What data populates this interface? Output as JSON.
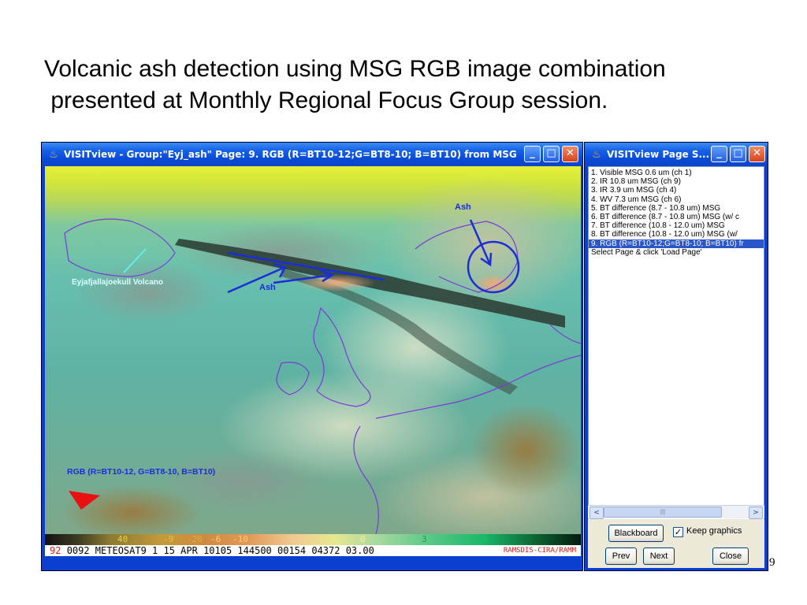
{
  "slide": {
    "title_line1": "Volcanic ash detection using MSG RGB image combination",
    "title_line2": " presented at Monthly Regional Focus Group session.",
    "page_number": "9"
  },
  "main_window": {
    "title": "VISITview - Group:\"Eyj_ash\" Page: 9. RGB (R=BT10-12;G=BT8-10; B=BT10) from MSG",
    "minimize": "_",
    "maximize": "□",
    "close": "✕",
    "annotations": {
      "ash_label_right": "Ash",
      "ash_label_left": "Ash",
      "volcano_label": "Eyjafjallajoekull Volcano",
      "rgb_label": "RGB (R=BT10-12, G=BT8-10, B=BT10)"
    },
    "colorbar_ticks": [
      "40",
      "-9",
      "-20",
      "-6",
      "-10",
      "0",
      "3",
      "6"
    ],
    "status": {
      "code": "92",
      "text": "0092 METEOSAT9   1 15 APR 10105 144500 00154 04372 03.00",
      "source": "RAMSDIS-CIRA/RAMM"
    }
  },
  "page_window": {
    "title": "VISITview Page S...",
    "minimize": "_",
    "maximize": "□",
    "close": "✕",
    "items": [
      "1. Visible MSG 0.6 um (ch 1)",
      "2. IR 10.8 um MSG (ch 9)",
      "3. IR 3.9 um MSG (ch 4)",
      "4. WV 7.3 um MSG (ch 6)",
      "5. BT difference (8.7 - 10.8 um) MSG",
      "6. BT difference (8.7 - 10.8 um) MSG (w/ c",
      "7. BT difference (10.8 - 12.0 um) MSG",
      "8. BT difference (10.8 - 12.0 um) MSG (w/",
      "9. RGB (R=BT10-12;G=BT8-10; B=BT10) fr",
      "Select Page & click 'Load Page'"
    ],
    "selected_index": 8,
    "scroll_left": "<",
    "scroll_right": ">",
    "scroll_thumb": "|||",
    "buttons": {
      "blackboard": "Blackboard",
      "keep_graphics": "Keep graphics",
      "keep_graphics_checked": "✓",
      "prev": "Prev",
      "next": "Next",
      "close": "Close"
    }
  },
  "colors": {
    "annotation_blue": "#1a2ed8",
    "volcano_label": "#d8ffff",
    "arrow_red": "#e81010",
    "selection": "#2a56c8"
  }
}
